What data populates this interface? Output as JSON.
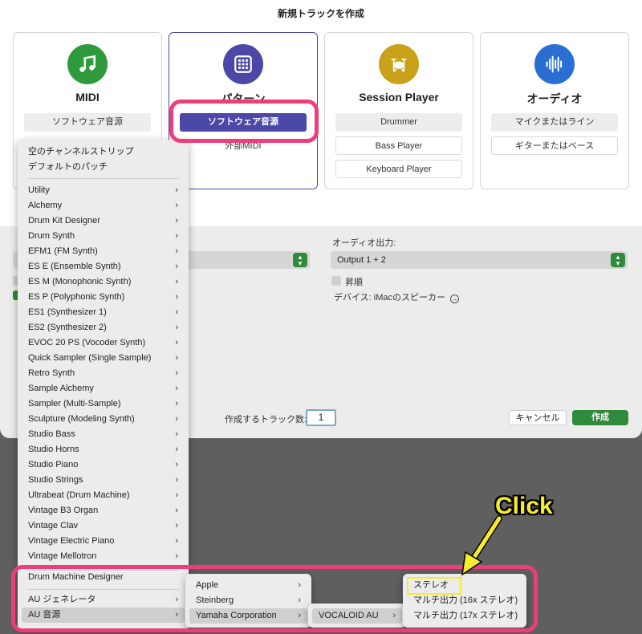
{
  "dialog": {
    "title": "新規トラックを作成",
    "cards": {
      "midi": {
        "title": "MIDI",
        "btn1": "ソフトウェア音源"
      },
      "pattern": {
        "title": "パターン",
        "btn1": "ソフトウェア音源",
        "btn2": "外部MIDI"
      },
      "session": {
        "title": "Session Player",
        "btn1": "Drummer",
        "btn2": "Bass Player",
        "btn3": "Keyboard Player"
      },
      "audio": {
        "title": "オーディオ",
        "btn1": "マイクまたはライン",
        "btn2": "ギターまたはベース"
      }
    },
    "audio_output": {
      "label": "オーディオ出力:",
      "value": "Output 1 + 2"
    },
    "ascending_label": "昇順",
    "device_text": "デバイス: iMacのスピーカー",
    "track_count": {
      "label": "作成するトラック数:",
      "value": "1"
    },
    "cancel": "キャンセル",
    "create": "作成"
  },
  "menu_main": {
    "top_items": [
      "空のチャンネルストリップ",
      "デフォルトのパッチ"
    ],
    "instruments": [
      "Utility",
      "Alchemy",
      "Drum Kit Designer",
      "Drum Synth",
      "EFM1 (FM Synth)",
      "ES E (Ensemble Synth)",
      "ES M (Monophonic Synth)",
      "ES P (Polyphonic Synth)",
      "ES1 (Synthesizer 1)",
      "ES2 (Synthesizer 2)",
      "EVOC 20 PS (Vocoder Synth)",
      "Quick Sampler (Single Sample)",
      "Retro Synth",
      "Sample Alchemy",
      "Sampler (Multi-Sample)",
      "Sculpture (Modeling Synth)",
      "Studio Bass",
      "Studio Horns",
      "Studio Piano",
      "Studio Strings",
      "Ultrabeat (Drum Machine)",
      "Vintage B3 Organ",
      "Vintage Clav",
      "Vintage Electric Piano",
      "Vintage Mellotron"
    ],
    "bottom_items": [
      "Drum Machine Designer",
      "AU ジェネレータ",
      "AU 音源"
    ]
  },
  "menu_au": [
    "Apple",
    "Steinberg",
    "Yamaha Corporation"
  ],
  "menu_yamaha": [
    "VOCALOID AU"
  ],
  "menu_vocaloid": [
    "ステレオ",
    "マルチ出力 (16x ステレオ)",
    "マルチ出力 (17x ステレオ)"
  ],
  "annotation": {
    "click_label": "Click"
  },
  "colors": {
    "accent": "#4b48a8",
    "green": "#2f8a3b",
    "highlight_pink": "#ee3e79",
    "annotation_yellow": "#f6ec2b"
  },
  "icons": {
    "midi": "music-note-icon",
    "pattern": "grid-pads-icon",
    "session": "drum-kit-icon",
    "audio": "waveform-icon"
  }
}
